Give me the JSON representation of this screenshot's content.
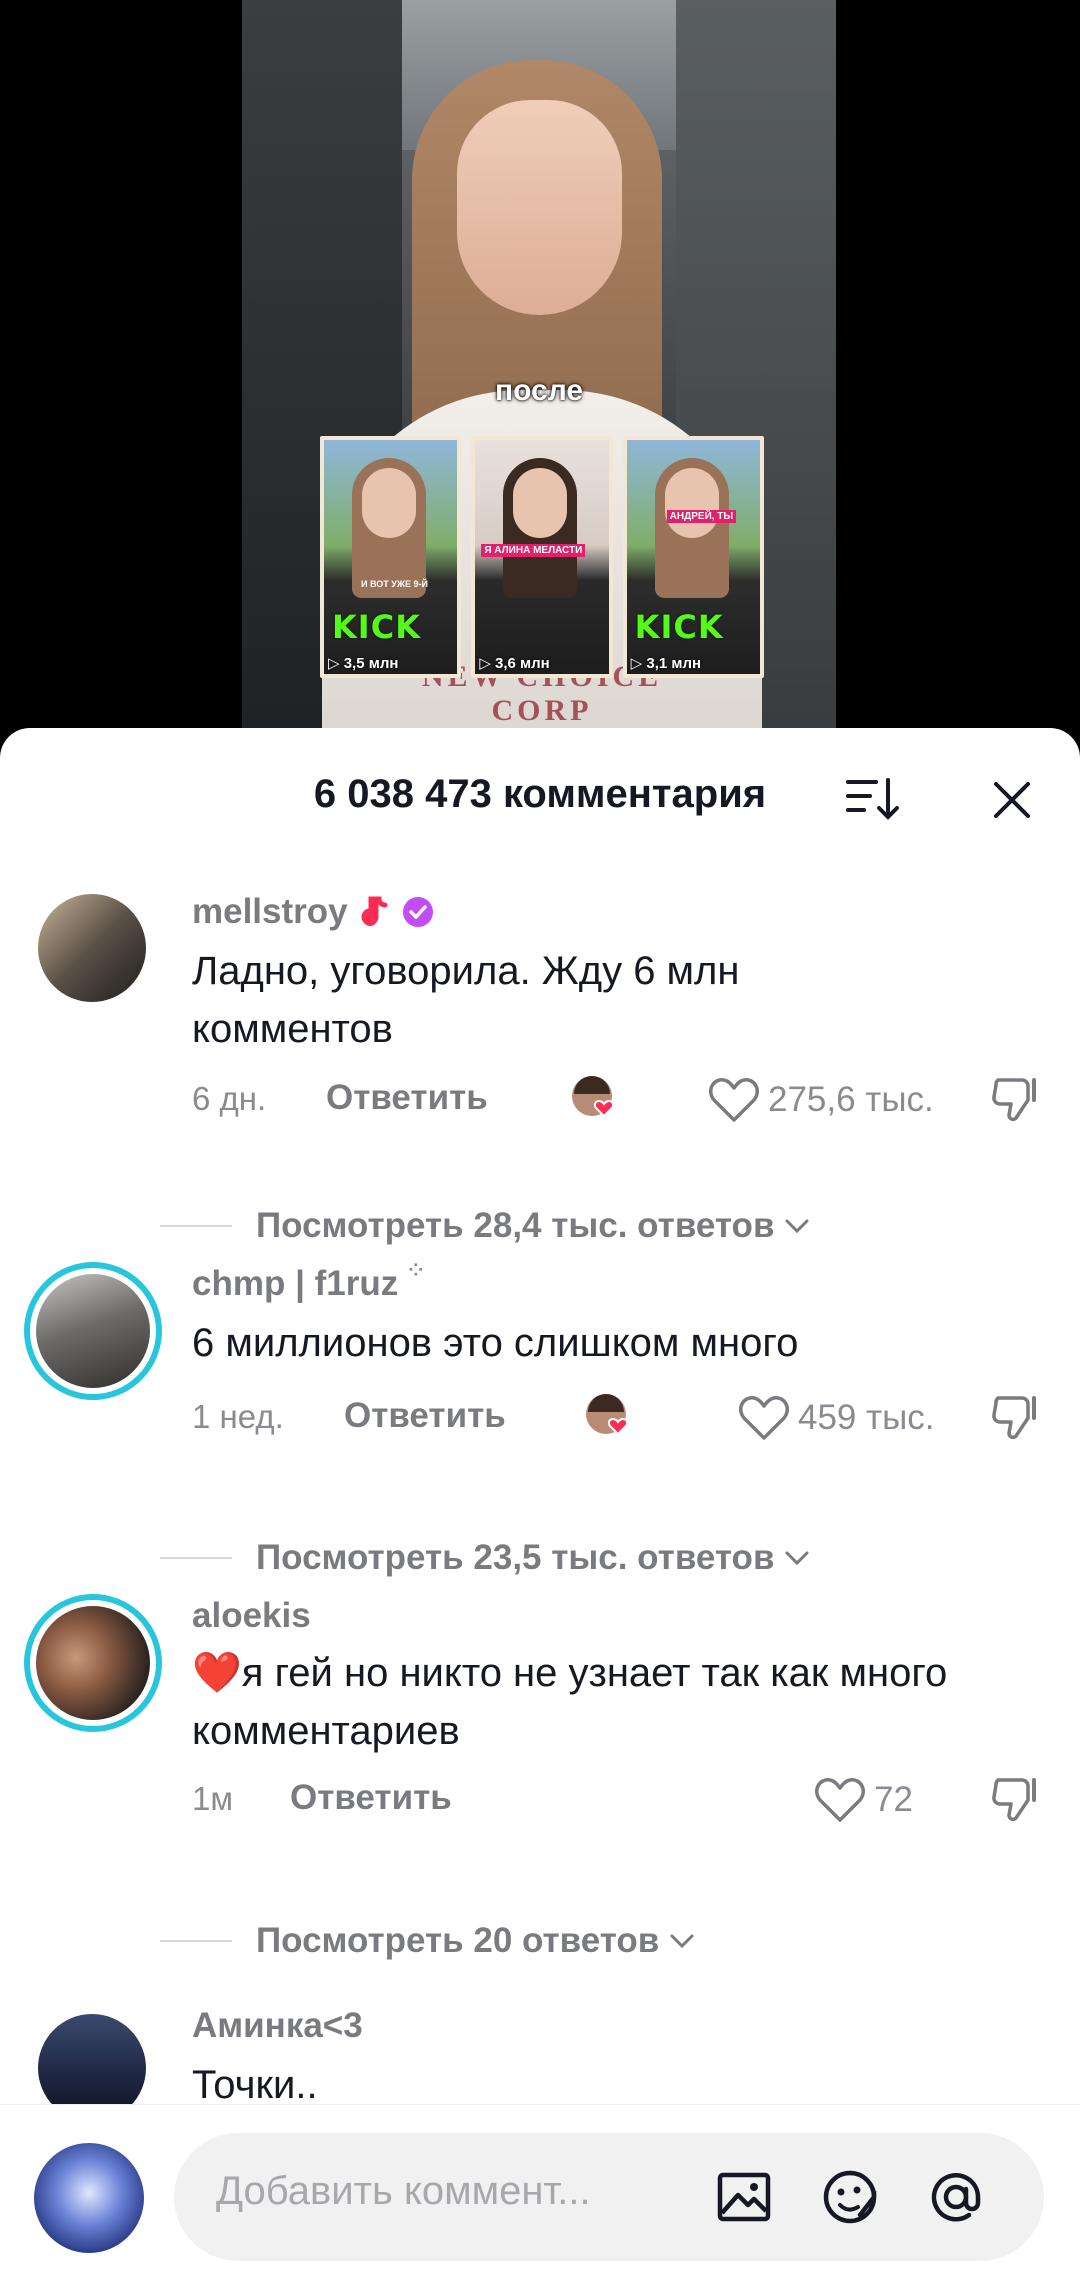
{
  "video": {
    "caption": "после",
    "shirt_print": "NEW CHOICE CORP",
    "thumbnails": [
      {
        "views": "▷ 3,5 млн",
        "kick": "KICK",
        "overlay": "И ВОТ УЖЕ 9-Й"
      },
      {
        "views": "▷ 3,6 млн",
        "kick": "",
        "overlay": "Я АЛИНА МЕЛАСТИ"
      },
      {
        "views": "▷ 3,1 млн",
        "kick": "KICK",
        "overlay": "АНДРЕЙ, ТЫ"
      }
    ]
  },
  "sheet": {
    "title": "6 038 473 комментария",
    "sort_icon": "sort-icon",
    "close_icon": "close-icon"
  },
  "comments": [
    {
      "username": "mellstroy",
      "text": "Ладно, уговорила. Жду 6 млн комментов",
      "time": "6 дн.",
      "reply_label": "Ответить",
      "likes": "275,6 тыс.",
      "view_replies": "Посмотреть 28,4 тыс. ответов",
      "avatar_color": "#3b3a36"
    },
    {
      "username": "chmp | f1ruz",
      "text": "6 миллионов это слишком много",
      "time": "1 нед.",
      "reply_label": "Ответить",
      "likes": "459 тыс.",
      "view_replies": "Посмотреть 23,5 тыс. ответов",
      "avatar_color": "#5a5c5e"
    },
    {
      "username": "aloekis",
      "text": "❤️я гей но никто не узнает так как много комментариев",
      "time": "1м",
      "reply_label": "Ответить",
      "likes": "72",
      "view_replies": "Посмотреть 20 ответов",
      "avatar_color": "#6a4a3a"
    },
    {
      "username": "Аминка<3",
      "text": "Точки..",
      "avatar_color": "#2a3550"
    }
  ],
  "input": {
    "placeholder": "Добавить коммент...",
    "icons": [
      "image-icon",
      "emoji-icon",
      "mention-icon"
    ]
  },
  "colors": {
    "accent_like": "#fe2c55",
    "verified": "#c34cf5",
    "story_ring": "#28c6dc",
    "kick_green": "#53fc18"
  }
}
